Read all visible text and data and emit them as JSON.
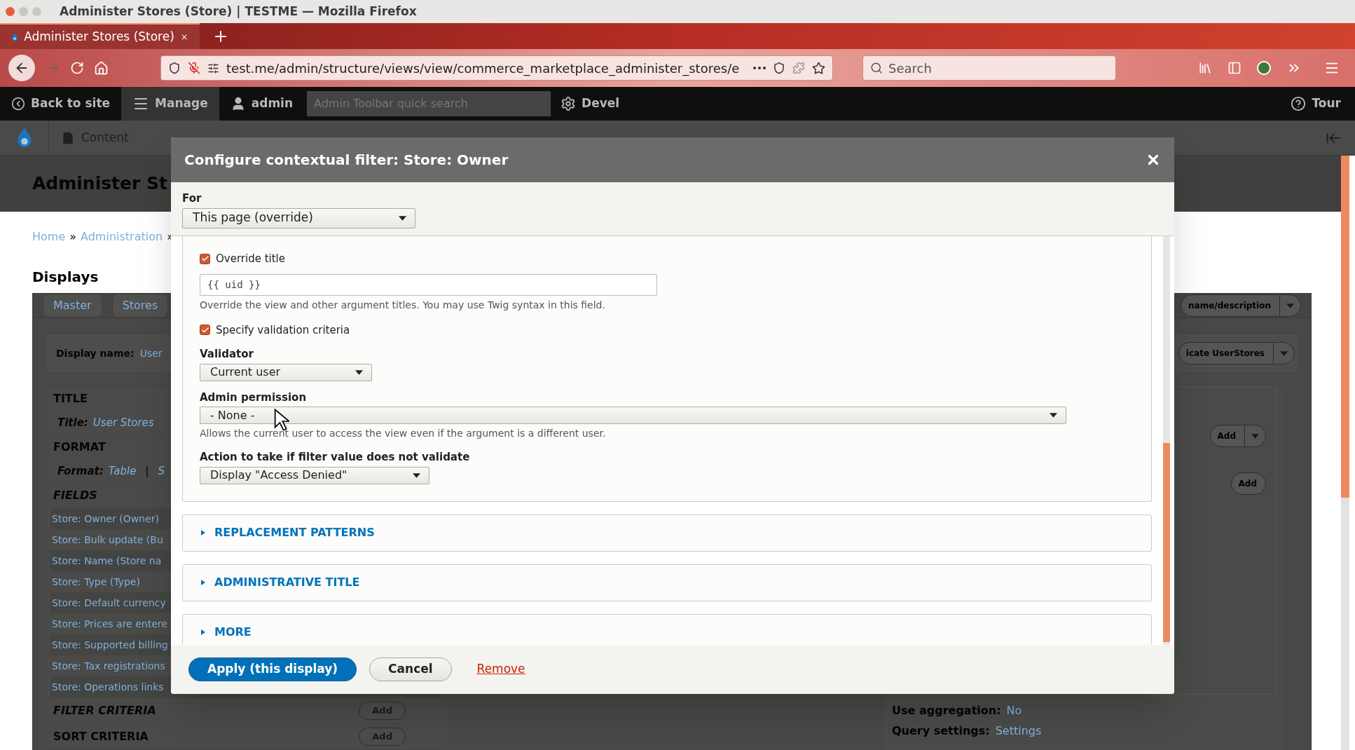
{
  "browser": {
    "window_title": "Administer Stores (Store) | TESTME — Mozilla Firefox",
    "tab_title": "Administer Stores (Store)",
    "url": "test.me/admin/structure/views/view/commerce_marketplace_administer_stores/e",
    "search_placeholder": "Search"
  },
  "admin_toolbar": {
    "items": [
      {
        "label": "Back to site",
        "kind": "back",
        "selected": false
      },
      {
        "label": "Manage",
        "kind": "menu",
        "selected": true
      },
      {
        "label": "admin",
        "kind": "user",
        "selected": false
      }
    ],
    "search_placeholder": "Admin Toolbar quick search",
    "devel": "Devel",
    "tour": "Tour"
  },
  "menu": {
    "items": [
      {
        "label": "Content"
      }
    ]
  },
  "page": {
    "title": "Administer St",
    "breadcrumb": [
      {
        "label": "Home",
        "separator": "»"
      },
      {
        "label": "Administration",
        "separator": "»"
      }
    ],
    "displays_heading": "Displays",
    "display_tabs": [
      "Master",
      "Stores"
    ],
    "edit_button": "name/description",
    "display_name_label": "Display name:",
    "display_name_value": "User",
    "duplicate_button": "icate UserStores",
    "left_sections": [
      {
        "heading": "TITLE",
        "overridden": false,
        "label": "Title:",
        "value": "User Stores"
      },
      {
        "heading": "FORMAT",
        "overridden": false,
        "label": "Format:",
        "value": "Table",
        "separator": "|",
        "extra": "S"
      },
      {
        "heading": "FIELDS",
        "overridden": true,
        "items": [
          "Store: Owner (Owner)",
          "Store: Bulk update (Bu",
          "Store: Name (Store na",
          "Store: Type (Type)",
          "Store: Default currency",
          "Store: Prices are entere",
          "Store: Supported billing",
          "Store: Tax registrations",
          "Store: Operations links"
        ]
      },
      {
        "heading": "FILTER CRITERIA",
        "overridden": true,
        "button": "Add"
      },
      {
        "heading": "SORT CRITERIA",
        "overridden": false,
        "button": "Add"
      }
    ],
    "right_buttons": [
      {
        "label": "Add",
        "kind": "split"
      },
      {
        "label": "Add",
        "kind": "plain"
      }
    ],
    "settings": [
      {
        "label": "Use aggregation:",
        "value": "No"
      },
      {
        "label": "Query settings:",
        "value": "Settings"
      }
    ]
  },
  "dialog": {
    "title": "Configure contextual filter: Store: Owner",
    "for_label": "For",
    "for_value": "This page (override)",
    "fields": [
      {
        "kind": "checkbox",
        "label": "Override title",
        "checked": true
      },
      {
        "kind": "text",
        "value": "{{ uid }}",
        "description": "Override the view and other argument titles. You may use Twig syntax in this field."
      },
      {
        "kind": "checkbox",
        "label": "Specify validation criteria",
        "checked": true
      },
      {
        "kind": "select",
        "label": "Validator",
        "value": "Current user"
      },
      {
        "kind": "select",
        "label": "Admin permission",
        "value": "- None -",
        "description": "Allows the current user to access the view even if the argument is a different user."
      },
      {
        "kind": "select",
        "label": "Action to take if filter value does not validate",
        "value": "Display \"Access Denied\""
      }
    ],
    "sections": [
      {
        "label": "REPLACEMENT PATTERNS",
        "expanded": false
      },
      {
        "label": "ADMINISTRATIVE TITLE",
        "expanded": false
      },
      {
        "label": "MORE",
        "expanded": false
      }
    ],
    "apply": "Apply (this display)",
    "cancel": "Cancel",
    "remove": "Remove"
  }
}
